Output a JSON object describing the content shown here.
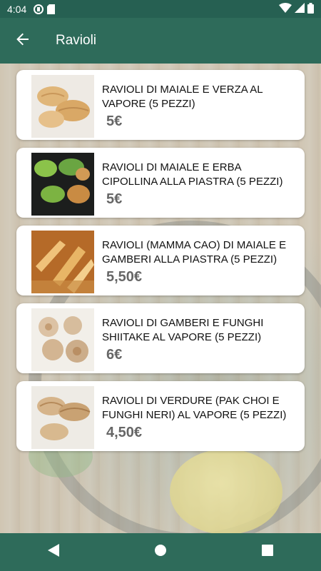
{
  "status_bar": {
    "time": "4:04"
  },
  "app_bar": {
    "title": "Ravioli",
    "back_icon": "arrow-back-icon"
  },
  "colors": {
    "primary": "#2e6b5a",
    "status": "#266052",
    "card": "#ffffff",
    "price": "#666666"
  },
  "items": [
    {
      "title": "RAVIOLI DI MAIALE E VERZA AL VAPORE (5 PEZZI)",
      "price": "5€"
    },
    {
      "title": "RAVIOLI DI MAIALE E ERBA CIPOLLINA ALLA PIASTRA (5 PEZZI)",
      "price": "5€"
    },
    {
      "title": "RAVIOLI (MAMMA CAO) DI MAIALE E GAMBERI ALLA PIASTRA (5 PEZZI)",
      "price": "5,50€"
    },
    {
      "title": "RAVIOLI DI GAMBERI E FUNGHI SHIITAKE AL VAPORE (5 PEZZI)",
      "price": "6€"
    },
    {
      "title": "RAVIOLI DI VERDURE (PAK CHOI E FUNGHI NERI) AL VAPORE (5 PEZZI)",
      "price": "4,50€"
    }
  ],
  "nav_bar": {
    "back": "triangle-back-icon",
    "home": "circle-home-icon",
    "recents": "square-recents-icon"
  }
}
